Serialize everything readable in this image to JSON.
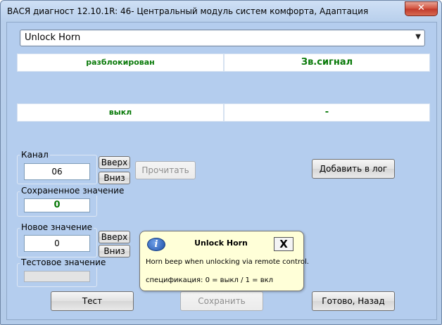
{
  "window": {
    "title": "ВАСЯ диагност 12.10.1R: 46- Центральный модуль систем комфорта, Адаптация"
  },
  "combo": {
    "selected": "Unlock Horn"
  },
  "grid": {
    "row1": [
      "разблокирован",
      "Зв.сигнал"
    ],
    "row2": [
      "выкл",
      "-"
    ]
  },
  "channel": {
    "label": "Канал",
    "value": "06",
    "up": "Вверх",
    "down": "Вниз",
    "read": "Прочитать"
  },
  "saved": {
    "label": "Сохраненное значение",
    "value": "0"
  },
  "newval": {
    "label": "Новое значение",
    "value": "0",
    "up": "Вверх",
    "down": "Вниз"
  },
  "testval": {
    "label": "Тестовое значение",
    "value": ""
  },
  "buttons": {
    "add_log": "Добавить в лог",
    "test": "Тест",
    "save": "Сохранить",
    "done": "Готово, Назад"
  },
  "tooltip": {
    "title": "Unlock Horn",
    "close": "X",
    "text": "Horn beep when unlocking via remote control.",
    "spec": "спецификация: 0 = выкл / 1 = вкл"
  },
  "icons": {
    "close": "close-icon",
    "info": "info-icon",
    "dropdown": "chevron-down-icon"
  }
}
